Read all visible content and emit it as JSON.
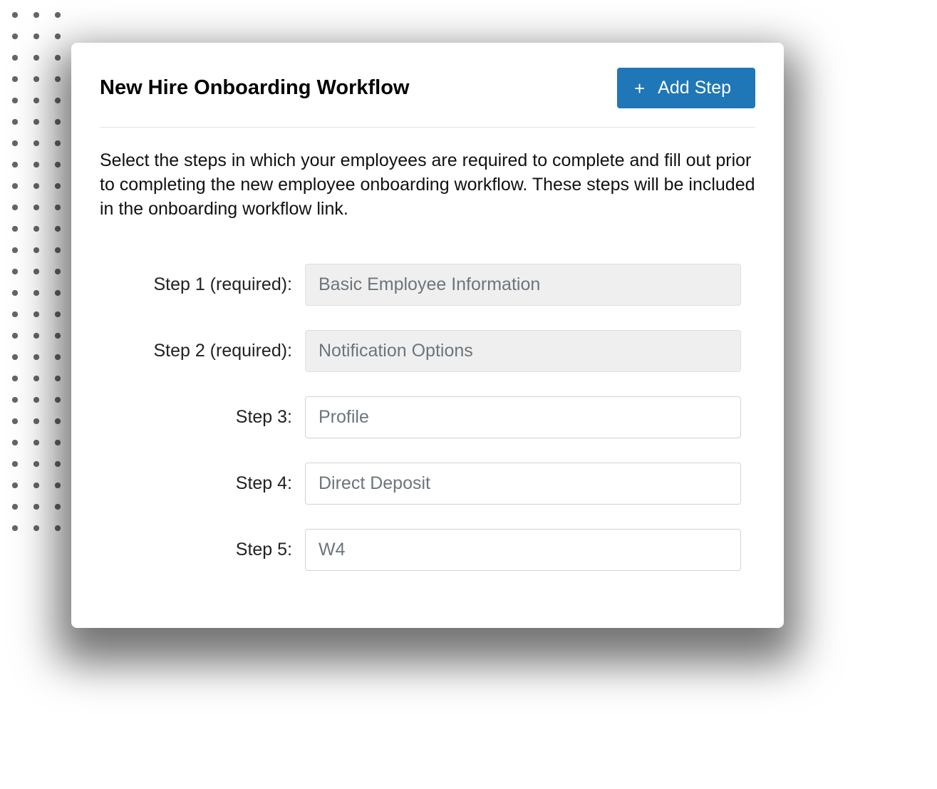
{
  "header": {
    "title": "New Hire Onboarding Workflow",
    "add_step_label": "Add Step"
  },
  "description": "Select the steps in which your employees are required to complete and fill out prior to completing the new employee onboarding workflow. These steps will be included in the onboarding workflow link.",
  "steps": [
    {
      "label": "Step 1 (required):",
      "value": "Basic Employee Information",
      "required": true
    },
    {
      "label": "Step 2 (required):",
      "value": "Notification Options",
      "required": true
    },
    {
      "label": "Step 3:",
      "value": "Profile",
      "required": false
    },
    {
      "label": "Step 4:",
      "value": "Direct Deposit",
      "required": false
    },
    {
      "label": "Step 5:",
      "value": "W4",
      "required": false
    }
  ],
  "colors": {
    "primary": "#1f77b7"
  }
}
